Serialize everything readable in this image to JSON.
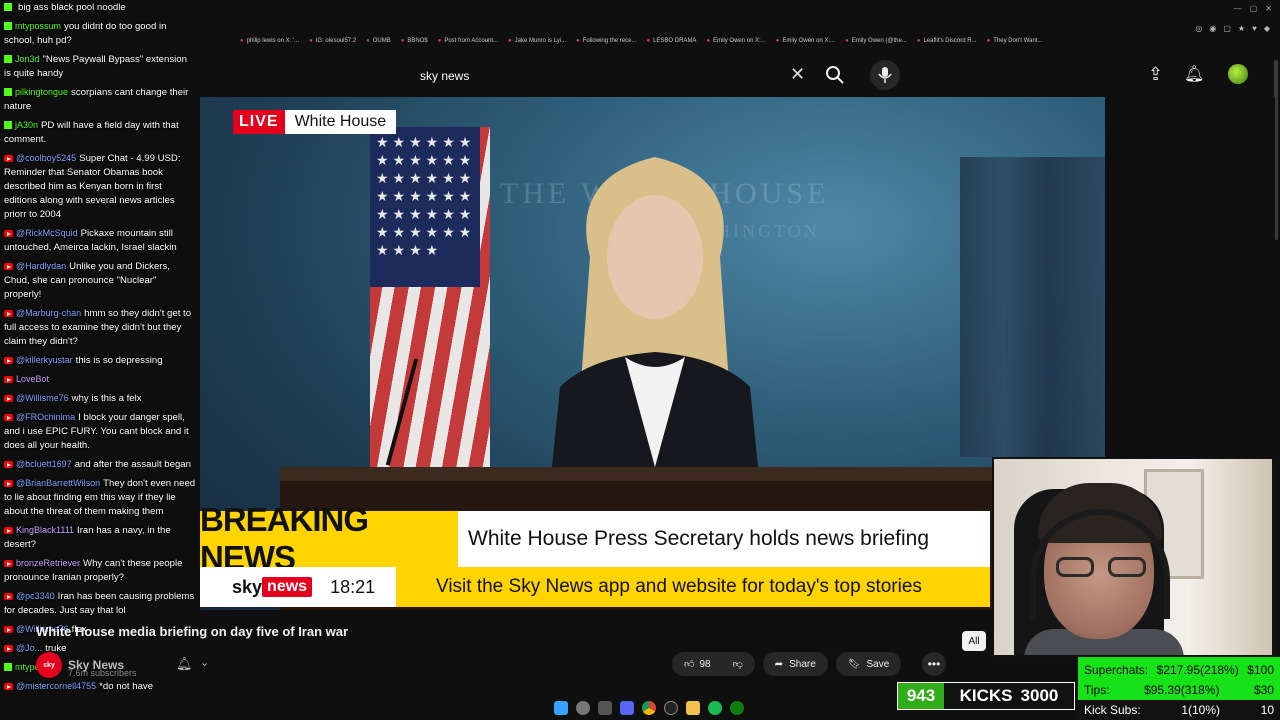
{
  "browser": {
    "bookmarks": [
      "philip lewis on X: '...",
      "IG: olesoul57.2",
      "OUMB",
      "BBNO$",
      "Post from Account...",
      "Jake Munro is Lyi...",
      "Following the rece...",
      "LESBO DRAMA",
      "Emily Owen on X:...",
      "Emily Owen on X:...",
      "Emily Owen (@the...",
      "Leaflit's Discord R...",
      "They Don't Want..."
    ]
  },
  "youtube": {
    "search_value": "sky news",
    "video_title": "White House media briefing on day five of Iran war",
    "channel_name": "Sky News",
    "channel_subs": "7.6m subscribers",
    "likes": "98",
    "share_label": "Share",
    "save_label": "Save",
    "chip_all": "All",
    "more_label": "•••"
  },
  "broadcast": {
    "live_tag": "LIVE",
    "live_location": "White House",
    "breaking_label": "BREAKING NEWS",
    "breaking_text": "White House Press Secretary holds news briefing",
    "logo_sky": "sky",
    "logo_news": "news",
    "clock": "18:21",
    "ticker_text": "Visit the Sky News app and website for today's top stories",
    "wall_text": "THE WHITE HOUSE",
    "wall_sub": "WASHINGTON"
  },
  "chat": [
    {
      "platform": "kick",
      "user": "",
      "text": "big ass black pool noodle"
    },
    {
      "platform": "kick",
      "user": "mtypossum",
      "text": "you didnt do too good in school, huh pd?"
    },
    {
      "platform": "kick",
      "user": "Jon3d",
      "text": "\"News Paywall Bypass\" extension is quite handy"
    },
    {
      "platform": "kick",
      "user": "pilkingtongue",
      "text": "scorpians cant change their nature"
    },
    {
      "platform": "kick",
      "user": "jA30n",
      "text": "PD will have a field day with that comment."
    },
    {
      "platform": "youtube",
      "user": "@coolboy5245",
      "text": "Super Chat - 4.99 USD: Reminder that Senator Obamas book described him as Kenyan born in first editions along with several news articles priorr to 2004"
    },
    {
      "platform": "youtube",
      "user": "@RickMcSquid",
      "text": "Pickaxe mountain still untouched, Ameirca lackin, Israel slackin"
    },
    {
      "platform": "youtube",
      "user": "@Hardlydan",
      "text": "Unlike you and Dickers, Chud, she can pronounce \"Nuclear\" properly!"
    },
    {
      "platform": "youtube",
      "user": "@Marburg-chan",
      "text": "hmm so they didn't get to full access to examine they didn't but they claim they didn't?"
    },
    {
      "platform": "youtube",
      "user": "@killerkyustar",
      "text": "this is so depressing"
    },
    {
      "platform": "other",
      "user": "LoveBot",
      "text": ""
    },
    {
      "platform": "youtube",
      "user": "@Willisme76",
      "text": "why is this a felx"
    },
    {
      "platform": "youtube",
      "user": "@FROchinima",
      "text": "I block your danger spell, and i use EPIC FURY. You cant block and it does all your health."
    },
    {
      "platform": "youtube",
      "user": "@bcluett1697",
      "text": "and after the assault began"
    },
    {
      "platform": "youtube",
      "user": "@BrianBarrettWilson",
      "text": "They don't even need to lie about finding em this way if they lie about the threat of them making them"
    },
    {
      "platform": "other",
      "user": "KingBlack1111",
      "text": "Iran has a navy, in the desert?"
    },
    {
      "platform": "other",
      "user": "bronzeRetriever",
      "text": "Why can't these people pronounce Iranian properly?"
    },
    {
      "platform": "youtube",
      "user": "@pc3340",
      "text": "Iran has been causing problems for decades. Just say that lol"
    },
    {
      "platform": "youtube",
      "user": "@Willisme76",
      "text": "flex"
    },
    {
      "platform": "youtube",
      "user": "@Jo...",
      "text": "truke"
    },
    {
      "platform": "kick",
      "user": "mtypossum",
      "text": ""
    },
    {
      "platform": "youtube",
      "user": "@mistercornell4755",
      "text": "*do not have"
    }
  ],
  "kick_goal": {
    "current": "943",
    "label": "KICKS",
    "target": "3000"
  },
  "stats": {
    "superchats_label": "Superchats:",
    "superchats_value": "$217.95(218%)",
    "superchats_goal": "$100",
    "tips_label": "Tips:",
    "tips_value": "$95.39(318%)",
    "tips_goal": "$30",
    "kicksubs_label": "Kick Subs:",
    "kicksubs_value": "1(10%)",
    "kicksubs_goal": "10"
  },
  "colors": {
    "kick_green": "#53fc18",
    "youtube_red": "#ff0000",
    "sky_red": "#e4001c",
    "breaking_yellow": "#ffd400"
  }
}
